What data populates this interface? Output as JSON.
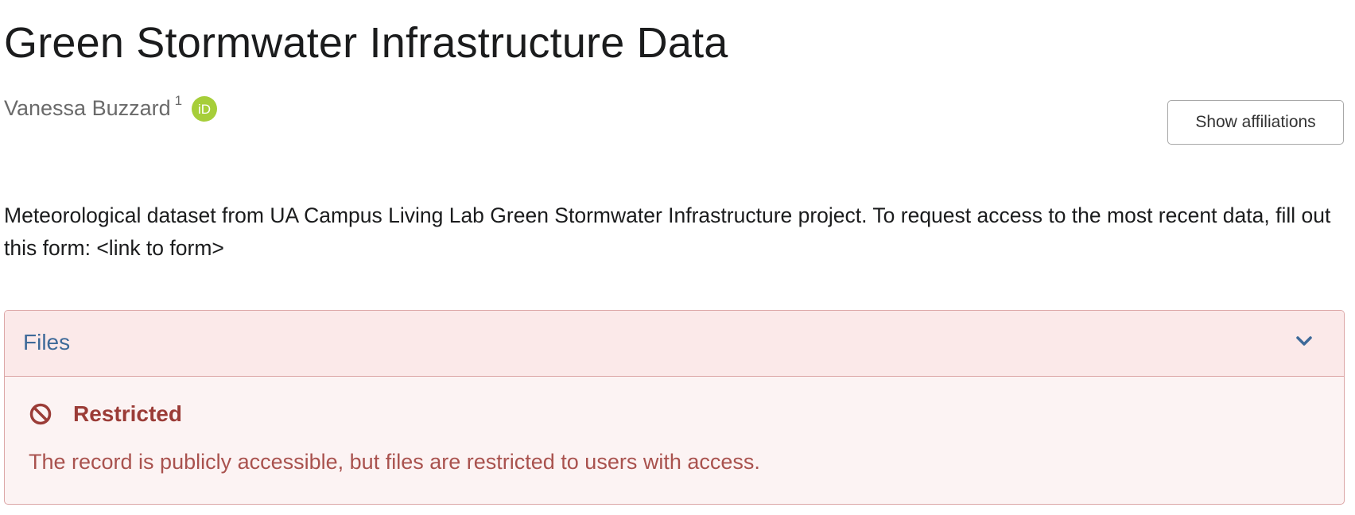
{
  "record": {
    "title": "Green Stormwater Infrastructure Data",
    "creator": {
      "name": "Vanessa Buzzard",
      "affiliation_index": "1",
      "orcid_icon": "orcid-icon",
      "orcid_text": "iD"
    },
    "show_affiliations_label": "Show affiliations",
    "description": "Meteorological dataset from UA Campus Living Lab Green Stormwater Infrastructure project.  To request access to the most recent data, fill out this form: <link to form>"
  },
  "files": {
    "title": "Files",
    "toggle_icon": "chevron-down-icon",
    "status_icon": "ban-icon",
    "status_label": "Restricted",
    "status_message": "The record is publicly accessible, but files are restricted to users with access."
  },
  "colors": {
    "orcid_green": "#a6ce39",
    "files_title": "#3e6a99",
    "restricted_label": "#9b3c37",
    "restricted_text": "#a9524e",
    "panel_border": "#dca7a7",
    "panel_header_bg": "#fbe9e9",
    "panel_body_bg": "#fcf3f3"
  }
}
